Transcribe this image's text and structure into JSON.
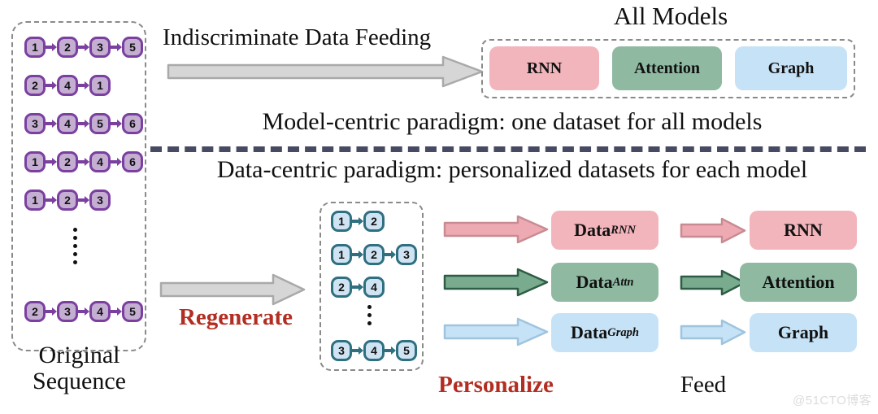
{
  "original": {
    "box_label_line1": "Original",
    "box_label_line2": "Sequence",
    "sequences": [
      [
        "1",
        "2",
        "3",
        "5"
      ],
      [
        "2",
        "4",
        "1"
      ],
      [
        "3",
        "4",
        "5",
        "6"
      ],
      [
        "1",
        "2",
        "4",
        "6"
      ],
      [
        "1",
        "2",
        "3"
      ],
      [
        "2",
        "3",
        "4",
        "5"
      ]
    ],
    "ellipsis": "⋮"
  },
  "top": {
    "feeding_label": "Indiscriminate Data Feeding",
    "all_models_title": "All Models",
    "models": [
      {
        "label": "RNN",
        "color": "#f2b5bc"
      },
      {
        "label": "Attention",
        "color": "#8fb9a1"
      },
      {
        "label": "Graph",
        "color": "#c6e2f6"
      }
    ],
    "paradigm_model": "Model-centric paradigm: one dataset for all models"
  },
  "bottom": {
    "paradigm_data": "Data-centric paradigm: personalized datasets for each model",
    "regenerate_label": "Regenerate",
    "personalize_label": "Personalize",
    "feed_label": "Feed",
    "regenerated_sequences": [
      [
        "1",
        "2"
      ],
      [
        "1",
        "2",
        "3"
      ],
      [
        "2",
        "4"
      ],
      [
        "3",
        "4",
        "5"
      ]
    ],
    "datasets": [
      {
        "name": "Data",
        "subscript": "RNN",
        "color": "#f2b5bc",
        "model": "RNN"
      },
      {
        "name": "Data",
        "subscript": "Attn",
        "color": "#8fb9a1",
        "model": "Attention"
      },
      {
        "name": "Data",
        "subscript": "Graph",
        "color": "#c6e2f6",
        "model": "Graph"
      }
    ]
  },
  "colors": {
    "node_purple_fill": "#c4aed2",
    "node_purple_border": "#7b3fa0",
    "node_teal_fill": "#cfe3f2",
    "node_teal_border": "#2e6f80",
    "accent_red": "#b32e22",
    "divider": "#474a63",
    "gray_arrow": "#d4d4d4",
    "gray_arrow_border": "#a8a8a8"
  },
  "watermark": "@51CTO博客"
}
